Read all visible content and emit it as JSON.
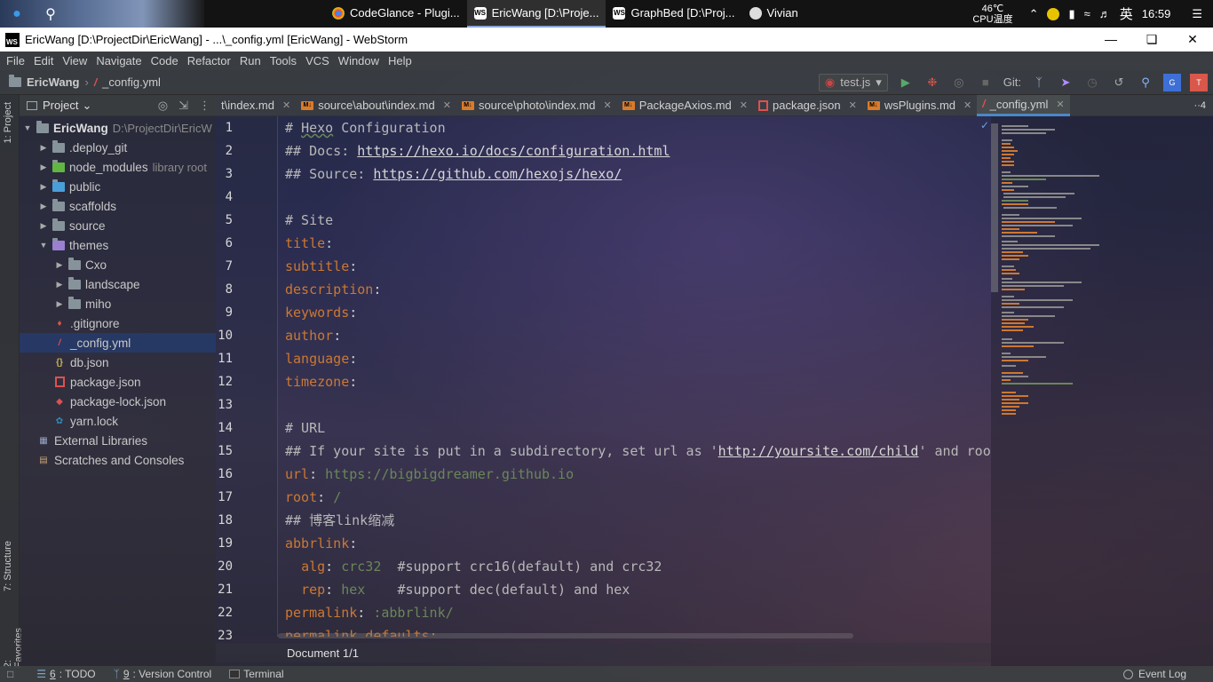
{
  "taskbar": {
    "apps": [
      {
        "label": "CodeGlance - Plugi...",
        "icon": "chrome-icon"
      },
      {
        "label": "EricWang [D:\\Proje...",
        "icon": "webstorm-icon"
      },
      {
        "label": "GraphBed [D:\\Proj...",
        "icon": "webstorm-icon"
      },
      {
        "label": "Vivian",
        "icon": "vivian-icon"
      }
    ],
    "temperature": "46℃",
    "temp_label": "CPU温度",
    "ime": "英",
    "clock": "16:59"
  },
  "window": {
    "title": "EricWang [D:\\ProjectDir\\EricWang] - ...\\_config.yml [EricWang] - WebStorm"
  },
  "menu": [
    "File",
    "Edit",
    "View",
    "Navigate",
    "Code",
    "Refactor",
    "Run",
    "Tools",
    "VCS",
    "Window",
    "Help"
  ],
  "breadcrumb": {
    "project": "EricWang",
    "file": "_config.yml"
  },
  "run_config": "test.js",
  "git_label": "Git:",
  "project_panel": {
    "title": "Project",
    "tool_tab": "1: Project",
    "structure_tab": "7: Structure",
    "favorites_tab": "2: Favorites",
    "root_name": "EricWang",
    "root_path": "D:\\ProjectDir\\EricW",
    "items": [
      {
        "name": ".deploy_git",
        "note": ""
      },
      {
        "name": "node_modules",
        "note": "library root"
      },
      {
        "name": "public",
        "note": ""
      },
      {
        "name": "scaffolds",
        "note": ""
      },
      {
        "name": "source",
        "note": ""
      },
      {
        "name": "themes",
        "note": ""
      },
      {
        "name": "Cxo",
        "note": ""
      },
      {
        "name": "landscape",
        "note": ""
      },
      {
        "name": "miho",
        "note": ""
      },
      {
        "name": ".gitignore",
        "note": ""
      },
      {
        "name": "_config.yml",
        "note": ""
      },
      {
        "name": "db.json",
        "note": ""
      },
      {
        "name": "package.json",
        "note": ""
      },
      {
        "name": "package-lock.json",
        "note": ""
      },
      {
        "name": "yarn.lock",
        "note": ""
      },
      {
        "name": "External Libraries",
        "note": ""
      },
      {
        "name": "Scratches and Consoles",
        "note": ""
      }
    ]
  },
  "tabs": [
    {
      "label": "t\\index.md"
    },
    {
      "label": "source\\about\\index.md"
    },
    {
      "label": "source\\photo\\index.md"
    },
    {
      "label": "PackageAxios.md"
    },
    {
      "label": "package.json"
    },
    {
      "label": "wsPlugins.md"
    },
    {
      "label": "_config.yml"
    }
  ],
  "tabs_more": "··4",
  "gutter": [
    "1",
    "2",
    "3",
    "4",
    "5",
    "6",
    "7",
    "8",
    "9",
    "10",
    "11",
    "12",
    "13",
    "14",
    "15",
    "16",
    "17",
    "18",
    "19",
    "20",
    "21",
    "22",
    "23"
  ],
  "code": {
    "l1a": "# ",
    "l1b": "Hexo",
    "l1c": " Configuration",
    "l2a": "## Docs: ",
    "l2b": "https://hexo.io/docs/configuration.html",
    "l3a": "## Source: ",
    "l3b": "https://github.com/hexojs/hexo/",
    "l5": "# Site",
    "l6": "title",
    "l7": "subtitle",
    "l8": "description",
    "l9": "keywords",
    "l10": "author",
    "l11": "language",
    "l12": "timezone",
    "l14": "# URL",
    "l15a": "## If your site is put in a subdirectory, set url as '",
    "l15b": "http://yoursite.com/child",
    "l15c": "' and roo",
    "l16k": "url",
    "l16v": "https://bigbigdreamer.github.io",
    "l17k": "root",
    "l17v": "/",
    "l18": "## 博客link缩减",
    "l19": "abbrlink",
    "l20k": "alg",
    "l20v": "crc32",
    "l20c": "#support crc16(default) and crc32",
    "l21k": "rep",
    "l21v": "hex",
    "l21c": "#support dec(default) and hex",
    "l22k": "permalink",
    "l22v": ":abbrlink/",
    "l23": "permalink_defaults:"
  },
  "doc_status": "Document 1/1",
  "statusbar": {
    "todo_num": "6",
    "todo": ": TODO",
    "vc_num": "9",
    "vc": ": Version Control",
    "terminal": "Terminal",
    "event_log": "Event Log"
  },
  "colors": {
    "keyword": "#cc7832",
    "string": "#6a8759",
    "accent": "#4a88c7"
  }
}
